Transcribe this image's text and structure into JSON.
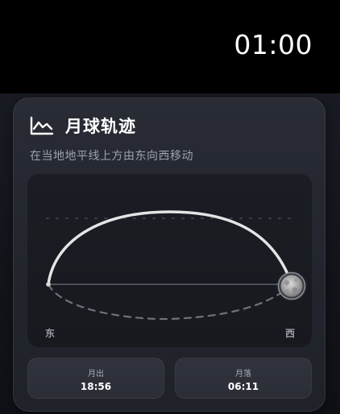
{
  "status_bar": {
    "time": "01:00"
  },
  "card": {
    "icon": "line-chart-icon",
    "title": "月球轨迹",
    "subtitle": "在当地地平线上方由东向西移动"
  },
  "orbit": {
    "east_label": "东",
    "west_label": "西",
    "moon_icon": "moon-icon"
  },
  "moonrise": {
    "label": "月出",
    "time": "18:56"
  },
  "moonset": {
    "label": "月落",
    "time": "06:11"
  }
}
